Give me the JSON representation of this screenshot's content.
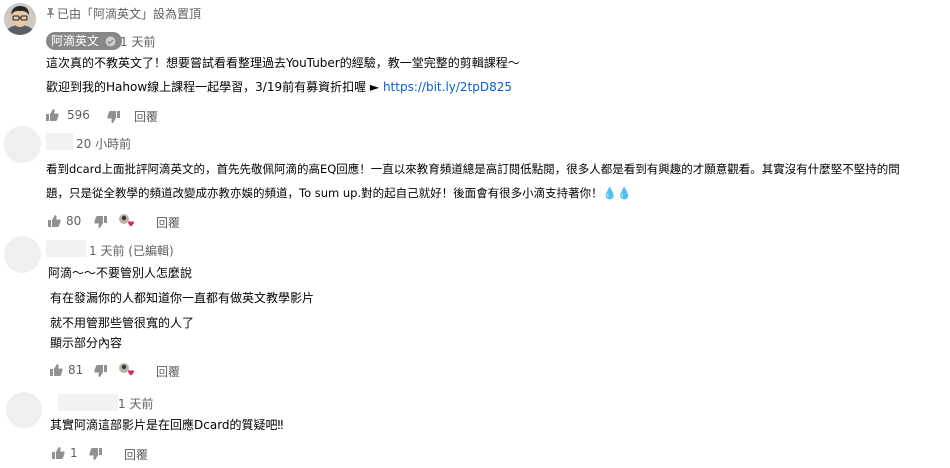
{
  "pinned": {
    "text": "已由「阿滴英文」設為置頂"
  },
  "comments": [
    {
      "author": "阿滴英文",
      "time": "1 天前",
      "lines": [
        "這次真的不教英文了！想要嘗試看看整理過去YouTuber的經驗，教一堂完整的剪輯課程～"
      ],
      "line2_prefix": "歡迎到我的Hahow線上課程一起學習，3/19前有募資折扣喔 ► ",
      "link": "https://bit.ly/2tpD825",
      "likes": "596",
      "reply": "回覆"
    },
    {
      "time": "20 小時前",
      "lines": [
        "看到dcard上面批評阿滴英文的，首先先敬佩阿滴的高EQ回應！一直以來教育頻道總是高訂閱低點閱，很多人都是看到有興趣的才願意觀看。其實沒有什麼堅不堅持的問",
        "題，只是從全教學的頻道改變成亦教亦娛的頻道，To sum up.對的起自己就好！後面會有很多小滴支持著你！💧💧"
      ],
      "likes": "80",
      "reply": "回覆"
    },
    {
      "time": "1 天前 (已編輯)",
      "lines": [
        "阿滴～～不要管別人怎麼說",
        "有在發漏你的人都知道你一直都有做英文教學影片",
        "就不用管那些管很寬的人了"
      ],
      "show_more": "顯示部分內容",
      "likes": "81",
      "reply": "回覆"
    },
    {
      "time": "1 天前",
      "lines": [
        "其實阿滴這部影片是在回應Dcard的質疑吧‼"
      ],
      "likes": "1",
      "reply": "回覆"
    }
  ],
  "icons": [
    "pin-icon",
    "verified-check-icon",
    "thumbs-up-icon",
    "thumbs-down-icon",
    "creator-heart-icon"
  ]
}
